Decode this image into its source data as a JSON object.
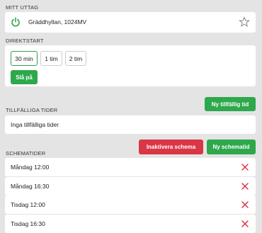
{
  "device_section": {
    "label": "MITT UTTAG",
    "device_name": "Gräddhyllan, 1024MV",
    "power_color": "#2ea84c"
  },
  "quick_start": {
    "label": "DIREKTSTART",
    "durations": [
      "30 min",
      "1 tim",
      "2 tim"
    ],
    "selected_duration": "30 min",
    "turn_on_label": "Slå på"
  },
  "temporary_times": {
    "label": "TILLFÄLLIGA TIDER",
    "new_button_label": "Ny tillfällig tid",
    "empty_text": "Inga tillfälliga tider"
  },
  "schedule": {
    "label": "SCHEMATIDER",
    "deactivate_label": "Inaktivera schema",
    "new_button_label": "Ny schematid",
    "items": [
      "Måndag 12:00",
      "Måndag 16:30",
      "Tisdag 12:00",
      "Tisdag 16:30"
    ]
  },
  "colors": {
    "accent_green": "#2ea84c",
    "danger_red": "#d93646"
  }
}
